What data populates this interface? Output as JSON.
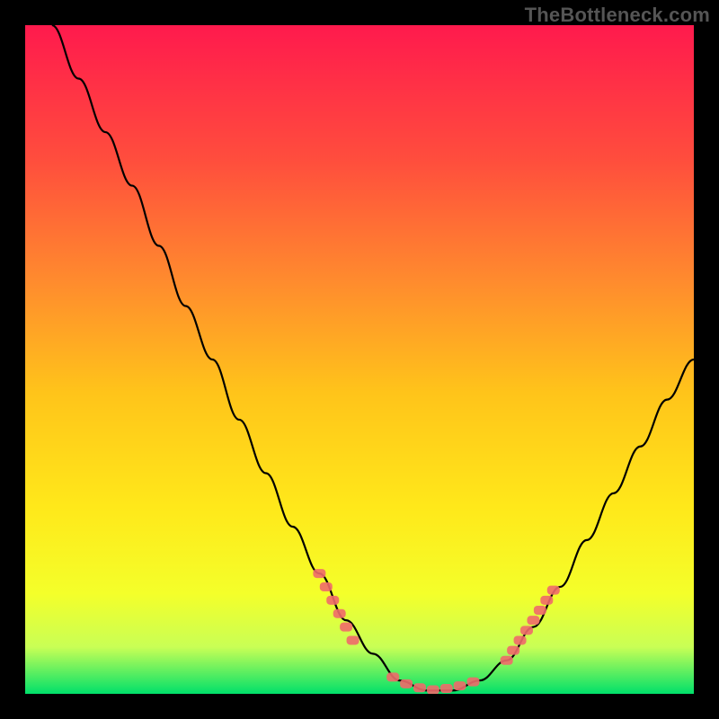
{
  "watermark": "TheBottleneck.com",
  "chart_data": {
    "type": "line",
    "title": "",
    "xlabel": "",
    "ylabel": "",
    "xlim": [
      0,
      100
    ],
    "ylim": [
      0,
      100
    ],
    "background_gradient": {
      "top": "#ff1a4d",
      "mid1": "#ff7a3a",
      "mid2": "#ffd21a",
      "mid3": "#faff2a",
      "low": "#c9ff55",
      "bottom": "#00e06a"
    },
    "series": [
      {
        "name": "bottleneck-curve",
        "type": "line",
        "color": "#000000",
        "points": [
          {
            "x": 4,
            "y": 100
          },
          {
            "x": 8,
            "y": 92
          },
          {
            "x": 12,
            "y": 84
          },
          {
            "x": 16,
            "y": 76
          },
          {
            "x": 20,
            "y": 67
          },
          {
            "x": 24,
            "y": 58
          },
          {
            "x": 28,
            "y": 50
          },
          {
            "x": 32,
            "y": 41
          },
          {
            "x": 36,
            "y": 33
          },
          {
            "x": 40,
            "y": 25
          },
          {
            "x": 44,
            "y": 18
          },
          {
            "x": 48,
            "y": 11
          },
          {
            "x": 52,
            "y": 6
          },
          {
            "x": 56,
            "y": 2
          },
          {
            "x": 60,
            "y": 0.5
          },
          {
            "x": 64,
            "y": 0.5
          },
          {
            "x": 68,
            "y": 2
          },
          {
            "x": 72,
            "y": 5
          },
          {
            "x": 76,
            "y": 10
          },
          {
            "x": 80,
            "y": 16
          },
          {
            "x": 84,
            "y": 23
          },
          {
            "x": 88,
            "y": 30
          },
          {
            "x": 92,
            "y": 37
          },
          {
            "x": 96,
            "y": 44
          },
          {
            "x": 100,
            "y": 50
          }
        ]
      },
      {
        "name": "highlight-markers",
        "type": "scatter",
        "color": "#ef6a6a",
        "points": [
          {
            "x": 44,
            "y": 18
          },
          {
            "x": 45,
            "y": 16
          },
          {
            "x": 46,
            "y": 14
          },
          {
            "x": 47,
            "y": 12
          },
          {
            "x": 48,
            "y": 10
          },
          {
            "x": 49,
            "y": 8
          },
          {
            "x": 55,
            "y": 2.5
          },
          {
            "x": 57,
            "y": 1.5
          },
          {
            "x": 59,
            "y": 0.9
          },
          {
            "x": 61,
            "y": 0.6
          },
          {
            "x": 63,
            "y": 0.8
          },
          {
            "x": 65,
            "y": 1.2
          },
          {
            "x": 67,
            "y": 1.8
          },
          {
            "x": 72,
            "y": 5
          },
          {
            "x": 73,
            "y": 6.5
          },
          {
            "x": 74,
            "y": 8
          },
          {
            "x": 75,
            "y": 9.5
          },
          {
            "x": 76,
            "y": 11
          },
          {
            "x": 77,
            "y": 12.5
          },
          {
            "x": 78,
            "y": 14
          },
          {
            "x": 79,
            "y": 15.5
          }
        ]
      }
    ]
  }
}
